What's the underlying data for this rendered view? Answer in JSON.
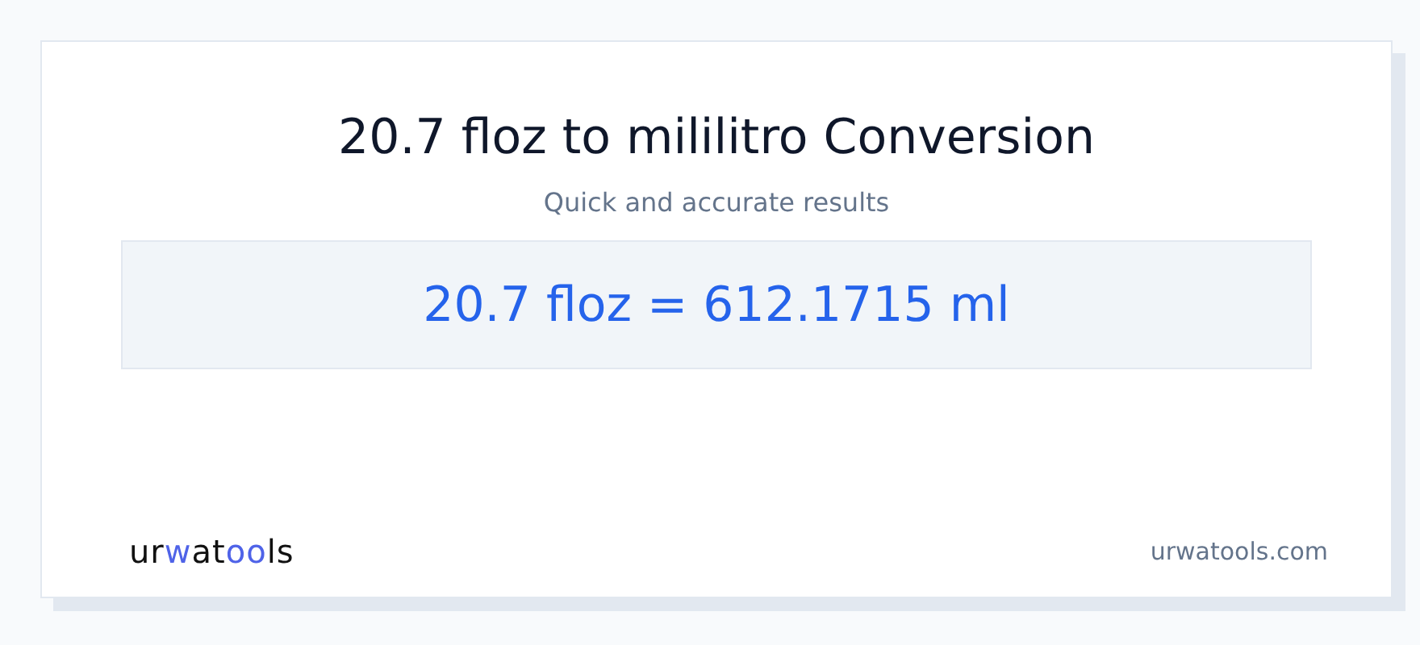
{
  "title": "20.7 floz to mililitro Conversion",
  "subtitle": "Quick and accurate results",
  "result": "20.7 floz = 612.1715 ml",
  "logo": [
    {
      "text": "ur",
      "accent": false
    },
    {
      "text": "w",
      "accent": true
    },
    {
      "text": "at",
      "accent": false
    },
    {
      "text": "oo",
      "accent": true
    },
    {
      "text": "ls",
      "accent": false
    }
  ],
  "site": "urwatools.com"
}
